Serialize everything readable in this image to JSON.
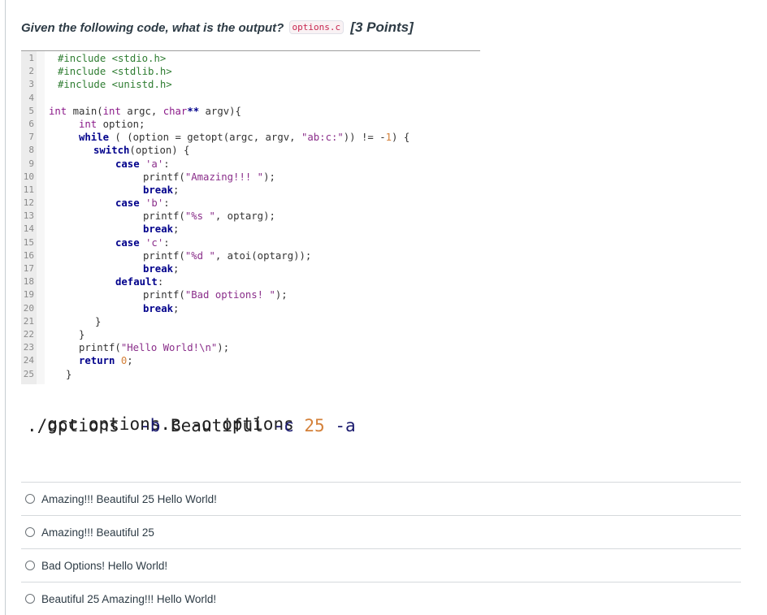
{
  "question": {
    "text": "Given the following code, what is the output?",
    "file_chip": "options.c",
    "points": "[3 Points]"
  },
  "code_lines": [
    {
      "n": "1",
      "text": "#include <stdio.h>"
    },
    {
      "n": "2",
      "text": "#include <stdlib.h>"
    },
    {
      "n": "3",
      "text": "#include <unistd.h>"
    },
    {
      "n": "4",
      "text": ""
    },
    {
      "n": "5",
      "text": "int main(int argc, char** argv){"
    },
    {
      "n": "6",
      "text": "int option;"
    },
    {
      "n": "7",
      "text": "while ( (option = getopt(argc, argv, \"ab:c:\")) != -1) {"
    },
    {
      "n": "8",
      "text": "switch(option) {"
    },
    {
      "n": "9",
      "text": "case 'a':"
    },
    {
      "n": "10",
      "text": "printf(\"Amazing!!! \");"
    },
    {
      "n": "11",
      "text": "break;"
    },
    {
      "n": "12",
      "text": "case 'b':"
    },
    {
      "n": "13",
      "text": "printf(\"%s \", optarg);"
    },
    {
      "n": "14",
      "text": "break;"
    },
    {
      "n": "15",
      "text": "case 'c':"
    },
    {
      "n": "16",
      "text": "printf(\"%d \", atoi(optarg));"
    },
    {
      "n": "17",
      "text": "break;"
    },
    {
      "n": "18",
      "text": "default:"
    },
    {
      "n": "19",
      "text": "printf(\"Bad options! \");"
    },
    {
      "n": "20",
      "text": "break;"
    },
    {
      "n": "21",
      "text": "}"
    },
    {
      "n": "22",
      "text": "}"
    },
    {
      "n": "23",
      "text": "printf(\"Hello World!\\n\");"
    },
    {
      "n": "24",
      "text": "return 0;"
    },
    {
      "n": "25",
      "text": "}"
    }
  ],
  "commands": {
    "compile": "gcc options.c -o options",
    "run": "./options  -b Beautiful -c 25 -a"
  },
  "answer_options": [
    "Amazing!!! Beautiful 25 Hello World!",
    "Amazing!!! Beautiful 25",
    "Bad Options! Hello World!",
    "Beautiful 25 Amazing!!! Hello World!"
  ]
}
